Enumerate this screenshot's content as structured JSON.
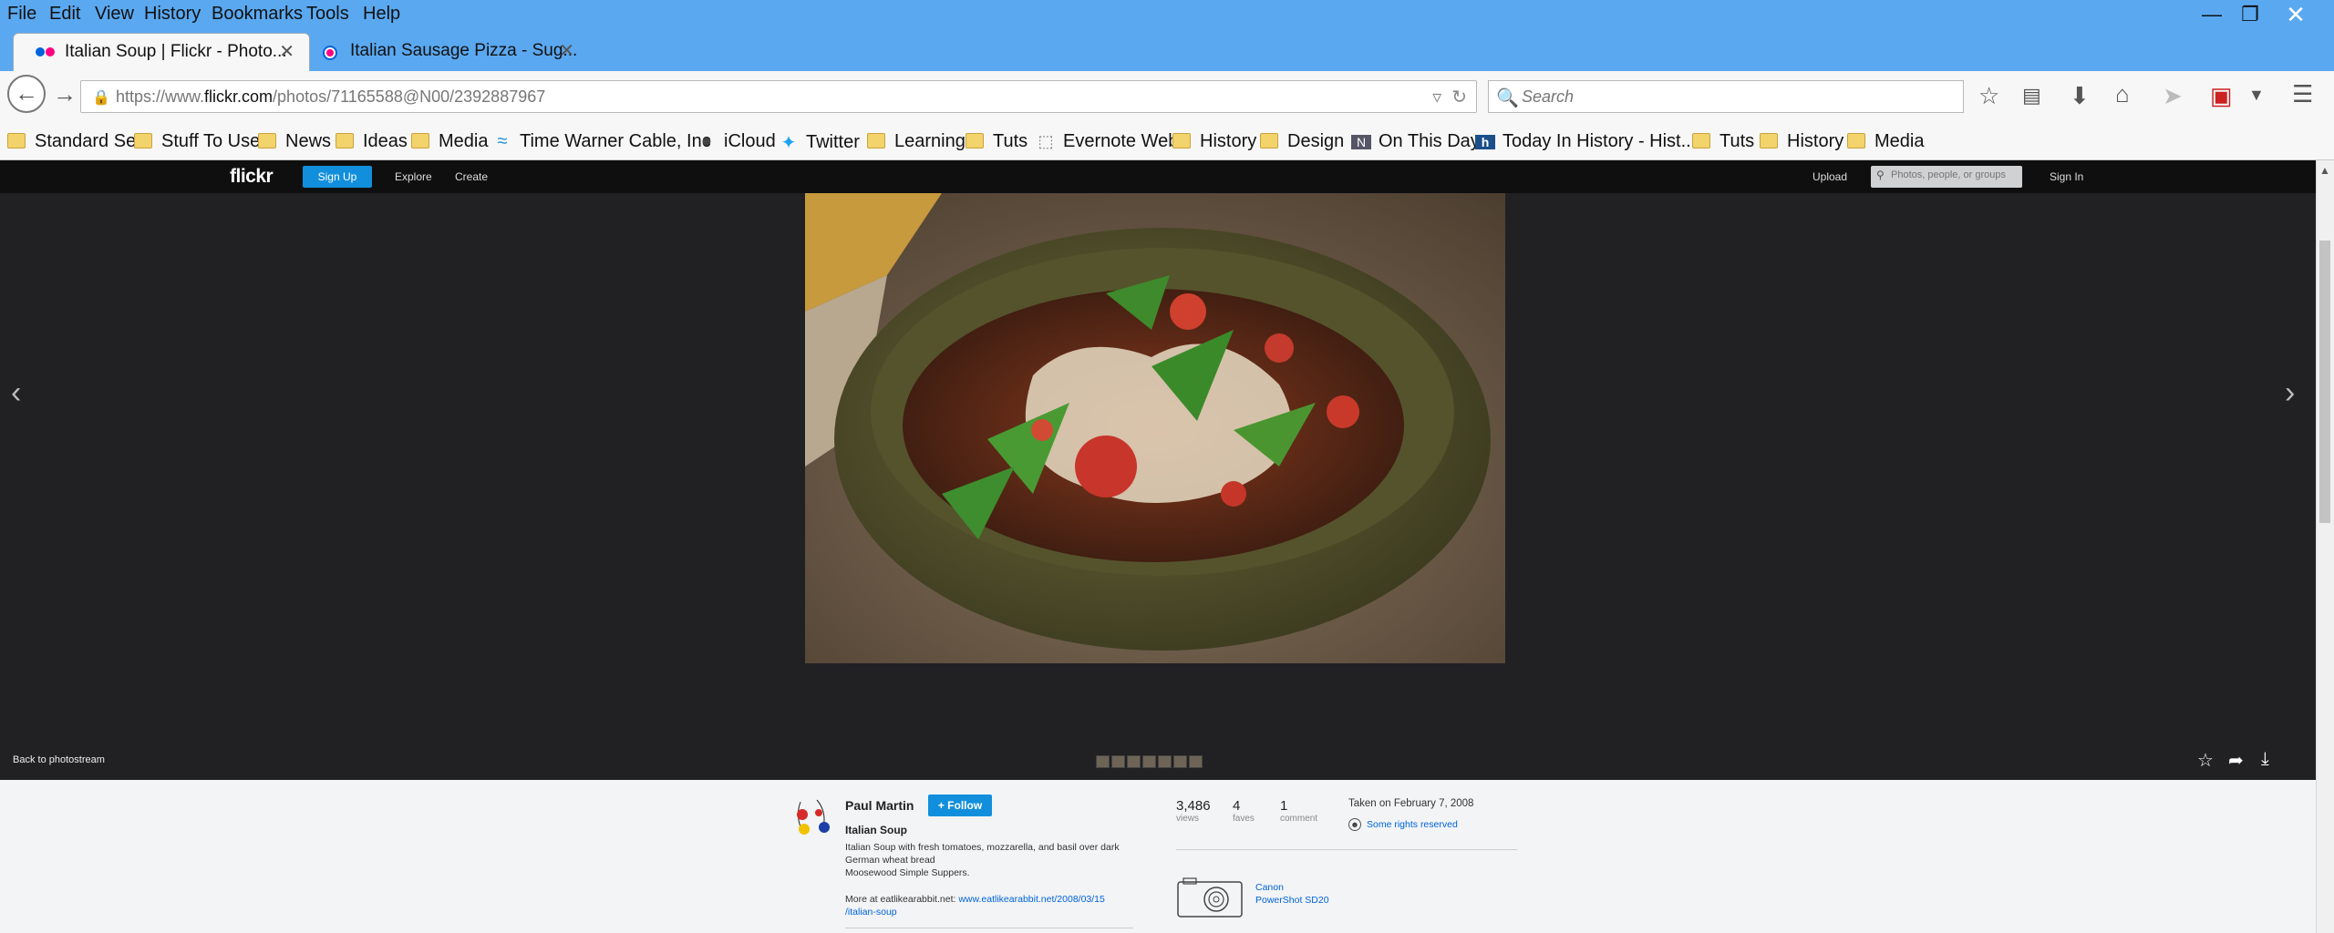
{
  "menu": {
    "file": "File",
    "edit": "Edit",
    "view": "View",
    "history": "History",
    "bookmarks": "Bookmarks",
    "tools": "Tools",
    "help": "Help"
  },
  "tabs": [
    {
      "title": "Italian Soup | Flickr - Photo...",
      "active": true
    },
    {
      "title": "Italian Sausage Pizza - Sug...",
      "active": false
    }
  ],
  "address": {
    "scheme": "https://www.",
    "domain": "flickr.com",
    "path": "/photos/71165588@N00/2392887967"
  },
  "search": {
    "placeholder": "Search"
  },
  "bookmarks": [
    {
      "label": "Standard Set",
      "icon": "folder-icon"
    },
    {
      "label": "Stuff To Use",
      "icon": "folder-icon"
    },
    {
      "label": "News",
      "icon": "folder-icon"
    },
    {
      "label": "Ideas",
      "icon": "folder-icon"
    },
    {
      "label": "Media",
      "icon": "folder-icon"
    },
    {
      "label": "Time Warner Cable, Inc",
      "icon": "twc-icon"
    },
    {
      "label": "iCloud",
      "icon": "apple-icon"
    },
    {
      "label": "Twitter",
      "icon": "twitter-icon"
    },
    {
      "label": "Learning",
      "icon": "folder-icon"
    },
    {
      "label": "Tuts",
      "icon": "folder-icon"
    },
    {
      "label": "Evernote Web",
      "icon": "page-icon"
    },
    {
      "label": "History",
      "icon": "folder-icon"
    },
    {
      "label": "Design",
      "icon": "folder-icon"
    },
    {
      "label": "On This Day",
      "icon": "nyt-icon"
    },
    {
      "label": "Today In History - Hist...",
      "icon": "history-icon"
    },
    {
      "label": "Tuts",
      "icon": "folder-icon"
    },
    {
      "label": "History",
      "icon": "folder-icon"
    },
    {
      "label": "Media",
      "icon": "folder-icon"
    }
  ],
  "flickr": {
    "logo": "flickr",
    "signup": "Sign Up",
    "explore": "Explore",
    "create": "Create",
    "upload": "Upload",
    "search_placeholder": "Photos, people, or groups",
    "signin": "Sign In",
    "back_to_photostream": "Back to photostream",
    "filmstrip_count": 7
  },
  "photo": {
    "author": "Paul Martin",
    "follow": "+ Follow",
    "title": "Italian Soup",
    "description_line1": "Italian Soup with fresh tomatoes, mozzarella, and basil over dark",
    "description_line2": "German wheat bread",
    "description_line3": "Moosewood Simple Suppers.",
    "more_prefix": "More at eatlikearabbit.net: ",
    "more_link_1": "www.eatlikearabbit.net/2008/03/15",
    "more_link_2": "/italian-soup",
    "views_count": "3,486",
    "views_label": "views",
    "faves_count": "4",
    "faves_label": "faves",
    "comments_count": "1",
    "comments_label": "comment",
    "taken": "Taken on February 7, 2008",
    "rights": "Some rights reserved",
    "camera_brand": "Canon",
    "camera_model": "PowerShot SD20"
  }
}
